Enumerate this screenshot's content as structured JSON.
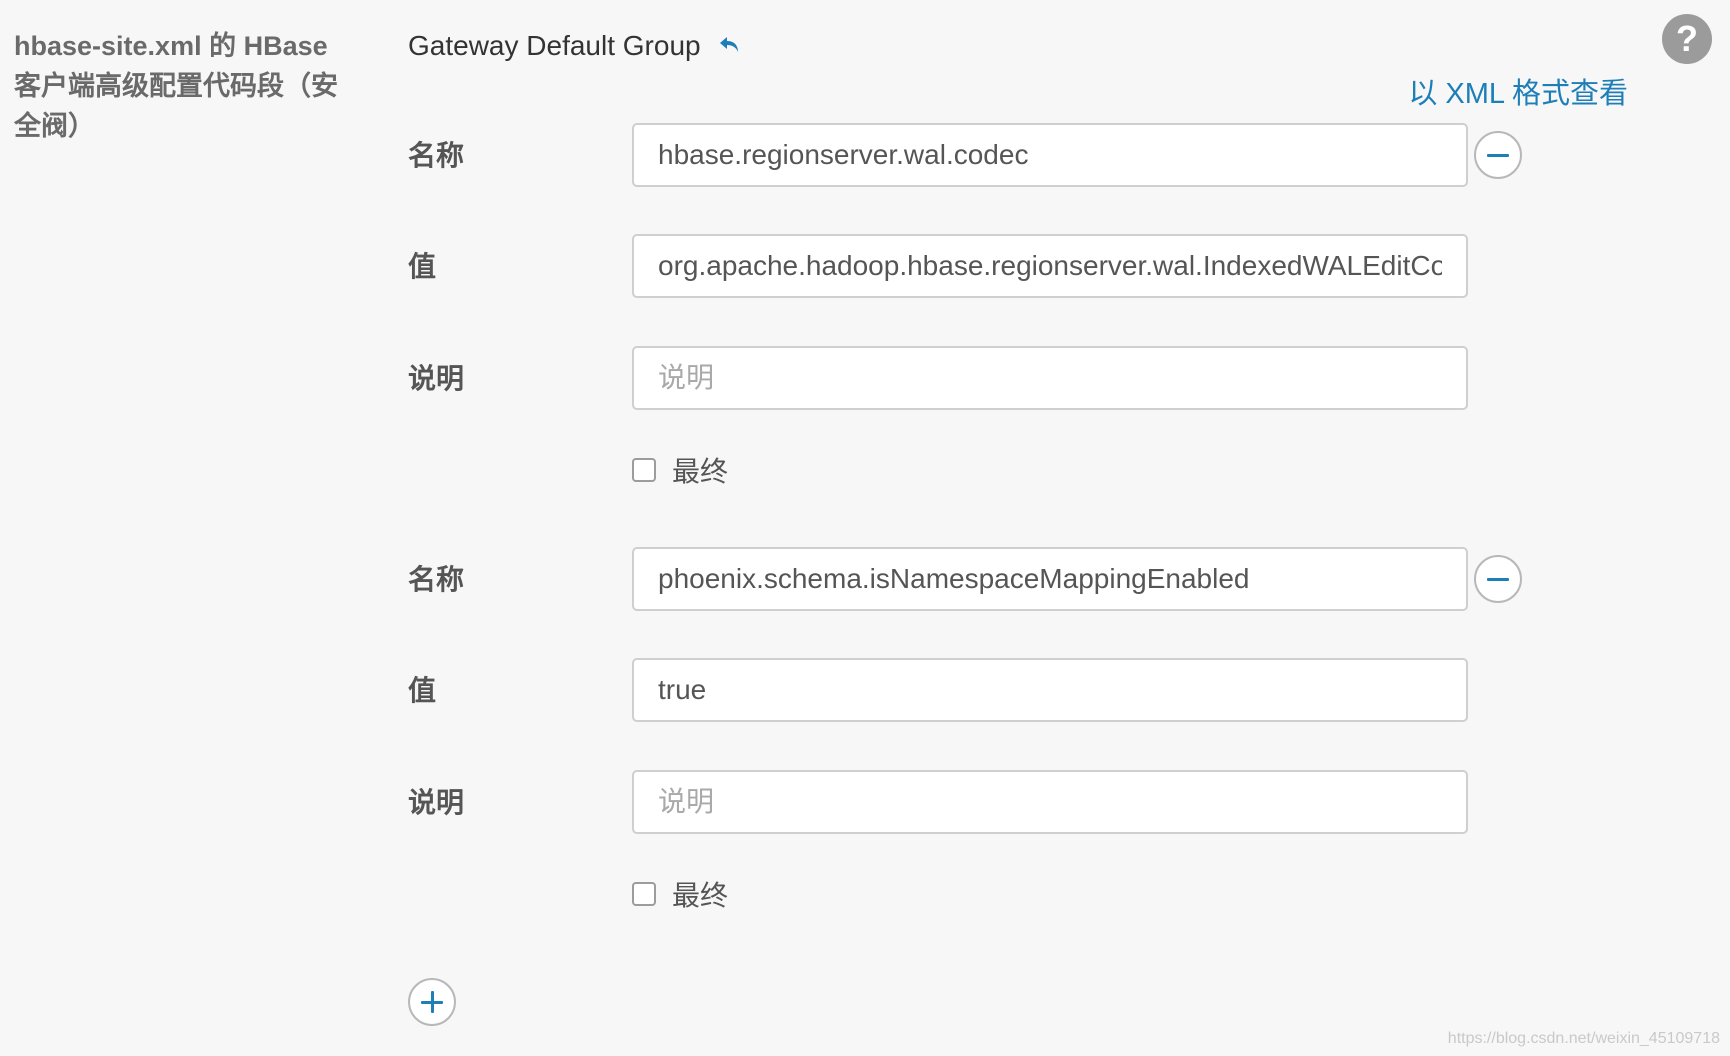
{
  "section": {
    "title": "hbase-site.xml 的 HBase 客户端高级配置代码段（安全阀）"
  },
  "group": {
    "title": "Gateway Default Group",
    "undo_icon": "undo-arrow-icon"
  },
  "links": {
    "view_xml": "以 XML 格式查看"
  },
  "help": {
    "icon": "question-mark-icon",
    "glyph": "?"
  },
  "labels": {
    "name": "名称",
    "value": "值",
    "description": "说明",
    "final": "最终"
  },
  "properties": [
    {
      "name": "hbase.regionserver.wal.codec",
      "value": "org.apache.hadoop.hbase.regionserver.wal.IndexedWALEditCodec",
      "description": "",
      "description_placeholder": "说明",
      "final": false
    },
    {
      "name": "phoenix.schema.isNamespaceMappingEnabled",
      "value": "true",
      "description": "",
      "description_placeholder": "说明",
      "final": false
    }
  ],
  "watermark": "https://blog.csdn.net/weixin_45109718",
  "colors": {
    "accent": "#1e7fb8",
    "background": "#f7f7f7",
    "help_icon": "#9b9b9b"
  }
}
